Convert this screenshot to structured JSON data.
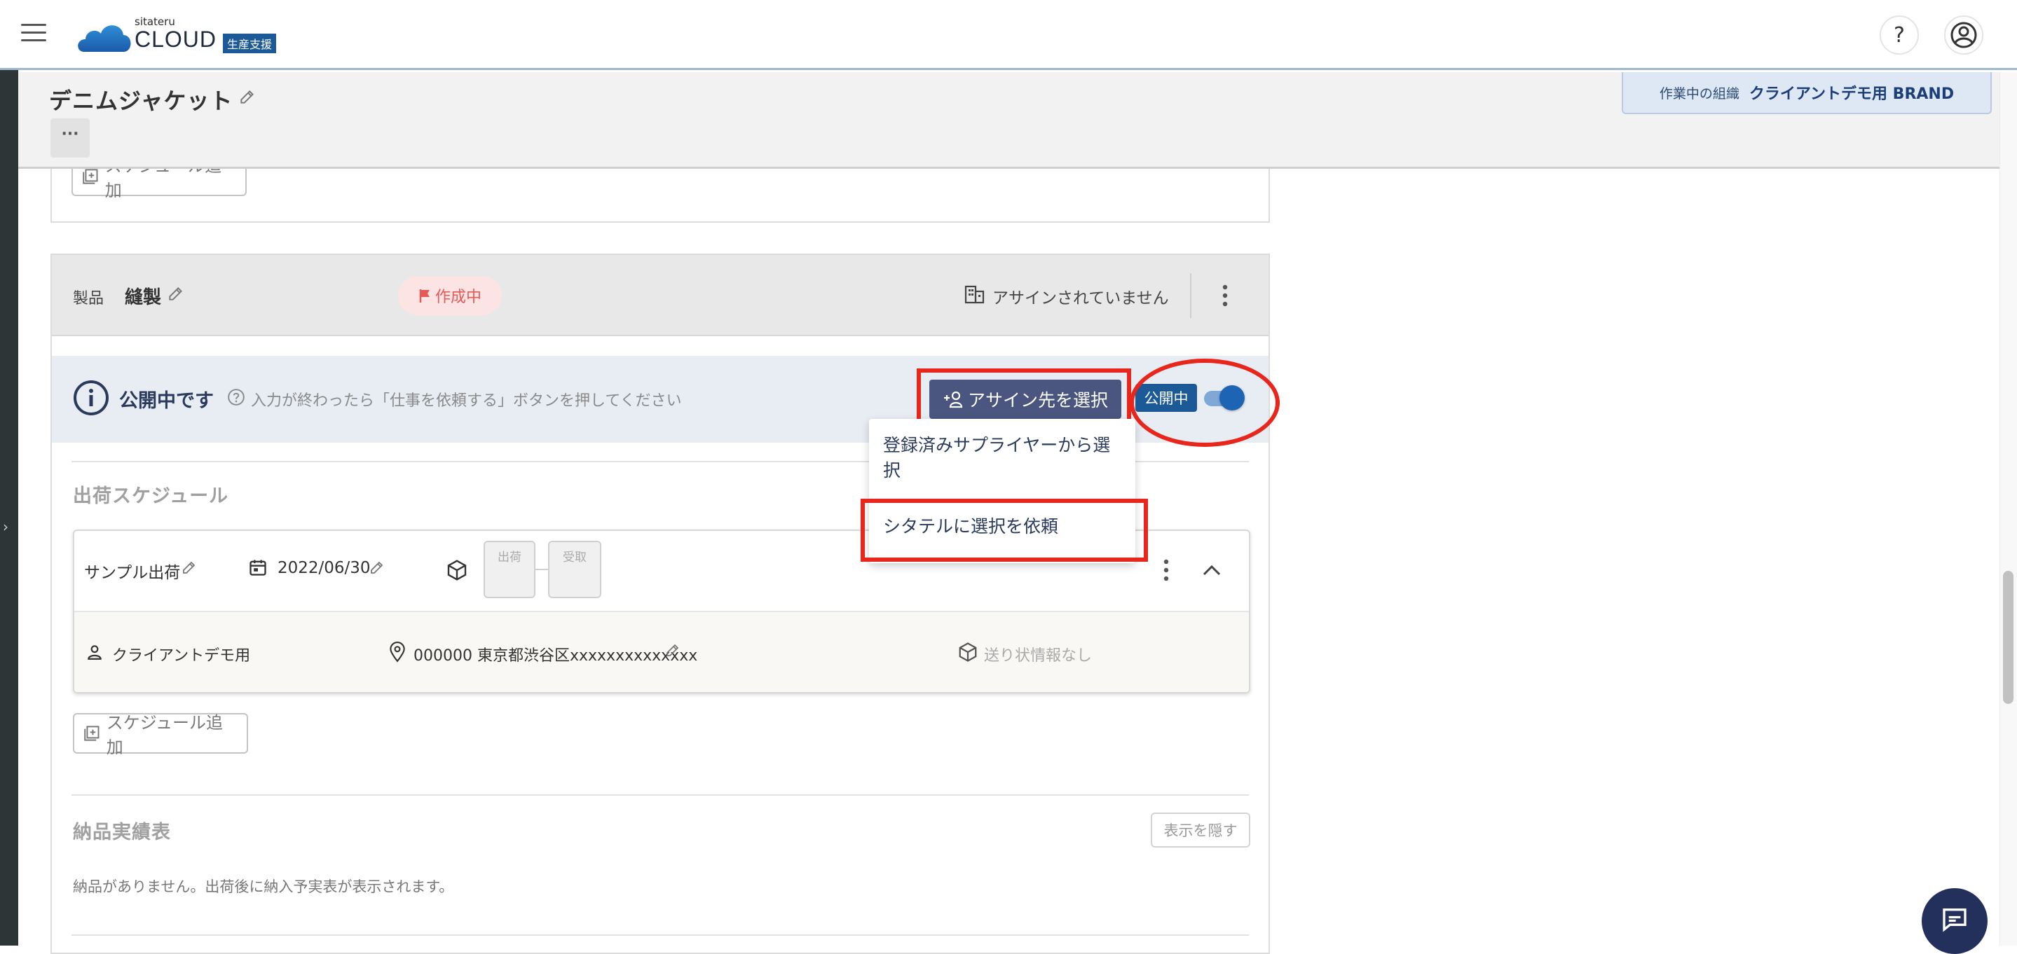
{
  "header": {
    "logo_small": "sitateru",
    "logo_main": "CLOUD",
    "logo_badge": "生産支援",
    "help_label": "?"
  },
  "title_band": {
    "page_title": "デニムジャケット",
    "org_label": "作業中の組織",
    "org_name": "クライアントデモ用 BRAND"
  },
  "top_card": {
    "add_schedule_label": "スケジュール追加"
  },
  "product": {
    "category_label": "製品",
    "name": "縫製",
    "status_badge": "作成中",
    "assign_status": "アサインされていません"
  },
  "publish_banner": {
    "title": "公開中です",
    "hint": "入力が終わったら「仕事を依頼する」ボタンを押してください",
    "assign_button": "アサイン先を選択",
    "public_badge": "公開中",
    "public_toggle_on": true
  },
  "assign_menu": {
    "items": [
      "登録済みサプライヤーから選択",
      "シタテルに選択を依頼"
    ]
  },
  "shipping": {
    "section_title": "出荷スケジュール",
    "schedule_name": "サンプル出荷",
    "date": "2022/06/30",
    "step_ship": "出荷",
    "step_receive": "受取",
    "recipient": "クライアントデモ用",
    "address": "000000 東京都渋谷区xxxxxxxxxxxxxx",
    "invoice_status": "送り状情報なし",
    "add_schedule_label": "スケジュール追加"
  },
  "delivery": {
    "section_title": "納品実績表",
    "hide_button": "表示を隠す",
    "empty_message": "納品がありません。出荷後に納入予実表が表示されます。"
  },
  "colors": {
    "annotation_red": "#e8261c",
    "primary_navy": "#4a5580",
    "toggle_blue": "#1e64b4",
    "badge_navy": "#1b5a96",
    "status_pink": "#fde4e4",
    "status_red": "#e55a55"
  }
}
